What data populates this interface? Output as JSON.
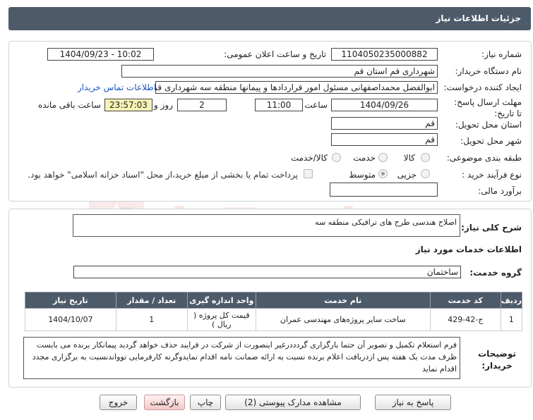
{
  "header": {
    "title": "جزئیات اطلاعات نیاز"
  },
  "form": {
    "need_number_label": "شماره نیاز:",
    "need_number": "1104050235000882",
    "announce_label": "تاریخ و ساعت اعلان عمومی:",
    "announce_value": "1404/09/23 - 10:02",
    "buyer_org_label": "نام دستگاه خریدار:",
    "buyer_org": "شهرداری قم استان قم",
    "requester_label": "ایجاد کننده درخواست:",
    "requester": "ابوالفضل محمداصفهانی مسئول امور قراردادها و پیمانها منطقه سه شهرداری قم",
    "buyer_contact_link": "اطلاعات تماس خریدار",
    "deadline_label": "مهلت ارسال پاسخ: تا تاریخ:",
    "deadline_date": "1404/09/26",
    "time_label": "ساعت",
    "deadline_time": "11:00",
    "days_value": "2",
    "days_label": "روز و",
    "remaining_time": "23:57:03",
    "remaining_label": "ساعت باقی مانده",
    "province_label": "استان محل تحویل:",
    "province": "قم",
    "city_label": "شهر محل تحویل:",
    "city": "قم",
    "category_label": "طبقه بندی موضوعی:",
    "category_options": [
      "کالا",
      "خدمت",
      "کالا/خدمت"
    ],
    "process_label": "نوع فرآیند خرید :",
    "process_options": [
      "جزیی",
      "متوسط"
    ],
    "payment_note": "پرداخت تمام یا بخشی از مبلغ خرید،از محل \"اسناد خزانه اسلامی\" خواهد بود.",
    "budget_label": "برآورد مالی:",
    "budget_value": ""
  },
  "summary": {
    "label": "شرح کلی نیاز:",
    "value": "اصلاح هندسی طرح های ترافیکی منطقه سه"
  },
  "services": {
    "section_title": "اطلاعات خدمات مورد نیاز",
    "group_label": "گروه خدمت:",
    "group_value": "ساختمان",
    "columns": [
      "ردیف",
      "کد خدمت",
      "نام خدمت",
      "واحد اندازه گیری",
      "تعداد / مقدار",
      "تاریخ نیاز"
    ],
    "rows": [
      {
        "row": "1",
        "code": "ج-42-429",
        "name": "ساخت سایر پروژه‌های مهندسی عمران",
        "unit": "قیمت کل پروژه ( ریال )",
        "qty": "1",
        "date": "1404/10/07"
      }
    ]
  },
  "buyer_notes": {
    "label": "توضیحات خریدار:",
    "value": "فرم استعلام تکمیل و تصویر آن حتما بارگزاری گردددرغیر اینصورت از شرکت در فرایند حذف خواهد گردید پیمانکار برنده می بایست ظرف مدت یک هفته پس ازدریافت اعلام برنده نسبت به ارائه ضمانت نامه اقدام نمایدوگرنه کارفرمایی توواندنسبت به برگزاری مجدد اقدام نماید"
  },
  "buttons": {
    "reply": "پاسخ به نیاز",
    "attachments": "مشاهده مدارک پیوستی (2)",
    "print": "چاپ",
    "back": "بازگشت",
    "exit": "خروج"
  },
  "watermark": "AriaTender.net",
  "colors": {
    "header": "#4d5a6a",
    "link": "#1a57c0",
    "yellow_field": "#f7f3b5"
  }
}
